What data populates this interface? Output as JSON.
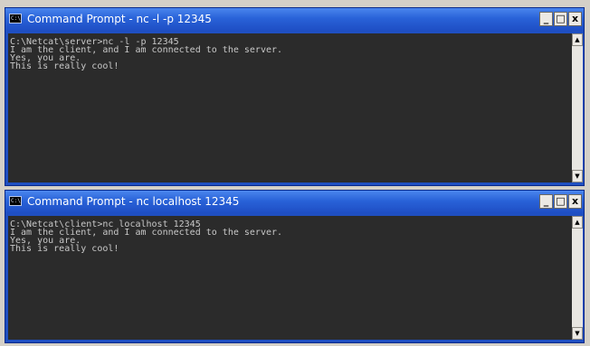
{
  "windows": [
    {
      "title": "Command Prompt - nc -l -p 12345",
      "icon_label": "C:\\",
      "lines": [
        "C:\\Netcat\\server>nc -l -p 12345",
        "I am the client, and I am connected to the server.",
        "Yes, you are.",
        "This is really cool!"
      ]
    },
    {
      "title": "Command Prompt - nc localhost 12345",
      "icon_label": "C:\\",
      "lines": [
        "C:\\Netcat\\client>nc localhost 12345",
        "I am the client, and I am connected to the server.",
        "Yes, you are.",
        "This is really cool!"
      ]
    }
  ],
  "controls": {
    "minimize": "_",
    "maximize": "□",
    "close": "x"
  },
  "scroll": {
    "up": "▲",
    "down": "▼"
  }
}
